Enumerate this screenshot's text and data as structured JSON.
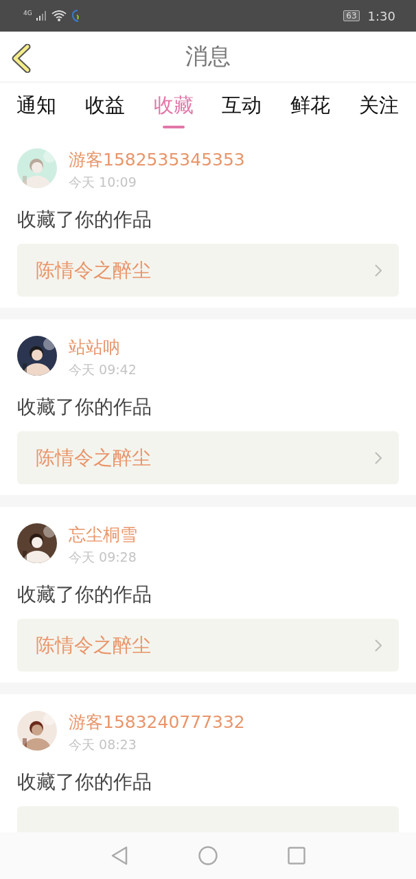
{
  "status_bar": {
    "network": "4G",
    "battery": "63",
    "time": "1:30"
  },
  "header": {
    "title": "消息"
  },
  "tabs": [
    {
      "label": "通知",
      "selected": false
    },
    {
      "label": "收益",
      "selected": false
    },
    {
      "label": "收藏",
      "selected": true
    },
    {
      "label": "互动",
      "selected": false
    },
    {
      "label": "鲜花",
      "selected": false
    },
    {
      "label": "关注",
      "selected": false
    }
  ],
  "messages": [
    {
      "user": "游客1582535345353",
      "time": "今天 10:09",
      "action": "收藏了你的作品",
      "work": "陈情令之醉尘"
    },
    {
      "user": "站站呐",
      "time": "今天 09:42",
      "action": "收藏了你的作品",
      "work": "陈情令之醉尘"
    },
    {
      "user": "忘尘桐雪",
      "time": "今天 09:28",
      "action": "收藏了你的作品",
      "work": "陈情令之醉尘"
    },
    {
      "user": "游客1583240777332",
      "time": "今天 08:23",
      "action": "收藏了你的作品"
    }
  ]
}
